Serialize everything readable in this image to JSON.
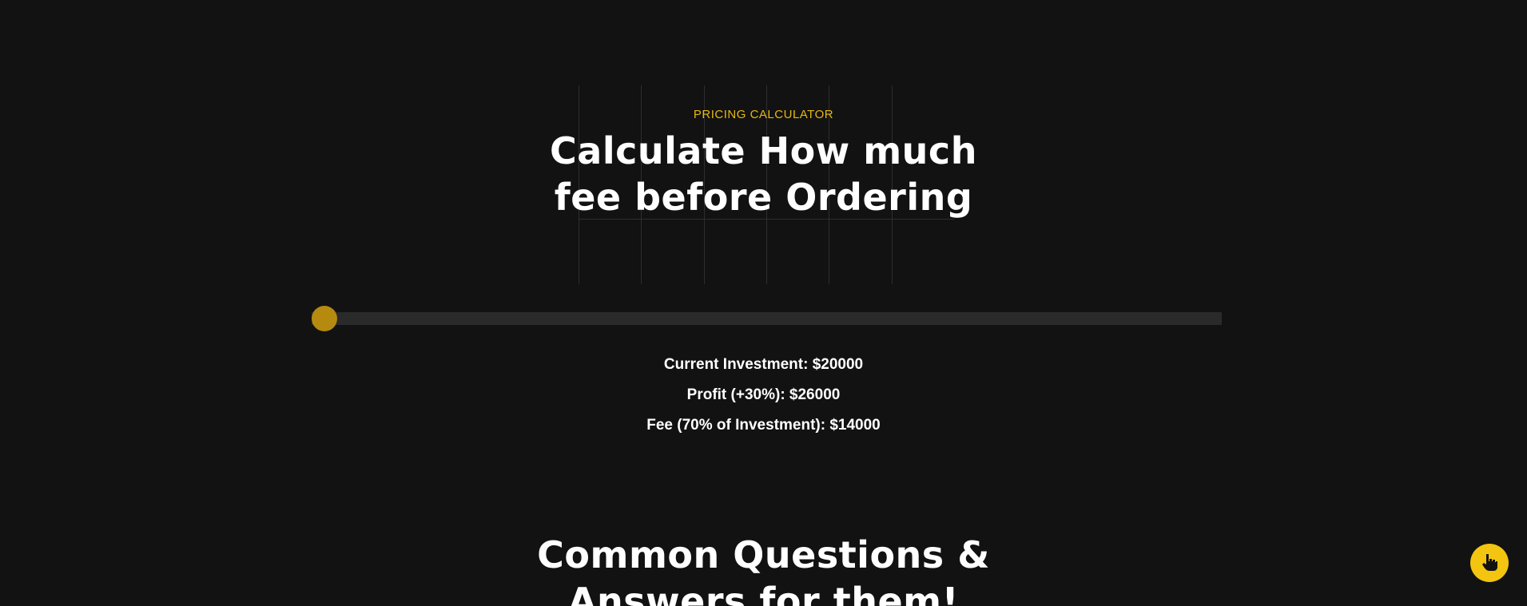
{
  "calculator": {
    "eyebrow": "PRICING CALCULATOR",
    "title_line1": "Calculate How much",
    "title_line2": "fee before Ordering",
    "slider": {
      "value_fraction": 0.0,
      "accent_color": "#b58a0f"
    },
    "results": {
      "investment": "Current Investment: $20000",
      "profit": "Profit (+30%): $26000",
      "fee": "Fee (70% of Investment): $14000"
    }
  },
  "faq": {
    "title_line1": "Common Questions &",
    "title_line2": "Answers for them!"
  },
  "floating_button": {
    "icon": "hand-pointer-icon",
    "color": "#f3c410"
  },
  "colors": {
    "background": "#121212",
    "accent": "#e7b812"
  }
}
